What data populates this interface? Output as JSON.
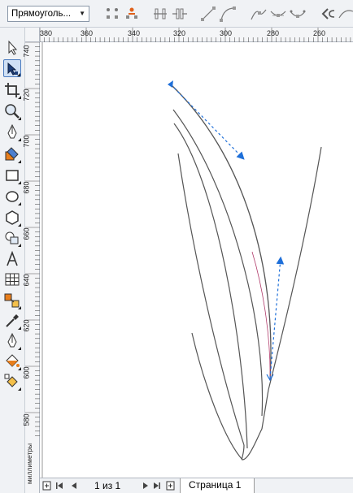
{
  "property_bar": {
    "object_type": "Прямоуголь...",
    "buttons": [
      "add-node",
      "delete-node",
      "join-nodes",
      "break-curve",
      "to-line",
      "to-curve",
      "cusp-node",
      "smooth-node",
      "symmetric-node",
      "reverse-direction"
    ]
  },
  "toolbox": {
    "tools": [
      {
        "name": "pick-tool-icon",
        "active": false
      },
      {
        "name": "shape-tool-icon",
        "active": true
      },
      {
        "name": "crop-tool-icon",
        "active": false
      },
      {
        "name": "zoom-tool-icon",
        "active": false
      },
      {
        "name": "freehand-tool-icon",
        "active": false
      },
      {
        "name": "smart-fill-tool-icon",
        "active": false
      },
      {
        "name": "rectangle-tool-icon",
        "active": false
      },
      {
        "name": "ellipse-tool-icon",
        "active": false
      },
      {
        "name": "polygon-tool-icon",
        "active": false
      },
      {
        "name": "basic-shapes-tool-icon",
        "active": false
      },
      {
        "name": "text-tool-icon",
        "active": false
      },
      {
        "name": "table-tool-icon",
        "active": false
      },
      {
        "name": "interactive-blend-tool-icon",
        "active": false
      },
      {
        "name": "eyedropper-tool-icon",
        "active": false
      },
      {
        "name": "outline-tool-icon",
        "active": false
      },
      {
        "name": "fill-tool-icon",
        "active": false
      },
      {
        "name": "interactive-fill-tool-icon",
        "active": false
      }
    ]
  },
  "ruler_h": {
    "labels": [
      "380",
      "360",
      "340",
      "320",
      "300",
      "280",
      "260"
    ]
  },
  "ruler_v": {
    "labels": [
      "740",
      "720",
      "700",
      "680",
      "660",
      "640",
      "620",
      "600",
      "580"
    ],
    "units": "миллиметры"
  },
  "statusbar": {
    "page_counter": "1 из 1",
    "page_tab": "Страница 1"
  },
  "colors": {
    "ui_bg": "#f0f2f5",
    "handle": "#1e6fd9",
    "curve": "#555555",
    "selected_curve": "#b03a6a"
  }
}
